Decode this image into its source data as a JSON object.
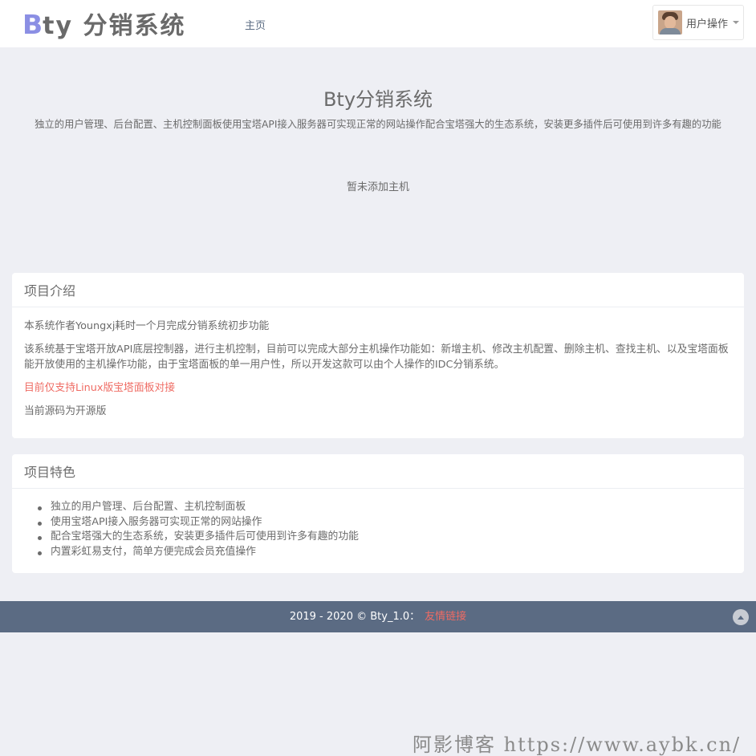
{
  "header": {
    "logo_b": "B",
    "logo_rest": "ty 分销系统",
    "nav_home": "主页",
    "user_menu_label": "用户操作"
  },
  "hero": {
    "title": "Bty分销系统",
    "subtitle": "独立的用户管理、后台配置、主机控制面板使用宝塔API接入服务器可实现正常的网站操作配合宝塔强大的生态系统，安装更多插件后可使用到许多有趣的功能",
    "empty_hosts": "暂未添加主机"
  },
  "intro": {
    "title": "项目介绍",
    "p1": "本系统作者Youngxj耗时一个月完成分销系统初步功能",
    "p2": "该系统基于宝塔开放API底层控制器，进行主机控制，目前可以完成大部分主机操作功能如：新增主机、修改主机配置、删除主机、查找主机、以及宝塔面板能开放使用的主机操作功能，由于宝塔面板的单一用户性，所以开发这款可以由个人操作的IDC分销系统。",
    "notice": "目前仅支持Linux版宝塔面板对接",
    "p3": "当前源码为开源版"
  },
  "features": {
    "title": "项目特色",
    "items": [
      "独立的用户管理、后台配置、主机控制面板",
      "使用宝塔API接入服务器可实现正常的网站操作",
      "配合宝塔强大的生态系统，安装更多插件后可使用到许多有趣的功能",
      "内置彩虹易支付，简单方便完成会员充值操作"
    ]
  },
  "footer": {
    "copyright": "2019 - 2020 © Bty_1.0：",
    "link": "友情链接"
  },
  "watermark": "阿影博客 https://www.aybk.cn/",
  "colors": {
    "background": "#eeeff4",
    "footer": "#5b6b83",
    "accent_red": "#ef6b63",
    "logo_b": "#8b8fe4"
  }
}
